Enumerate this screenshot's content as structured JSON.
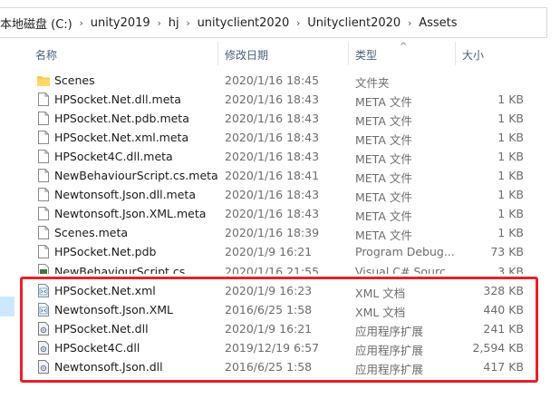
{
  "breadcrumb": [
    "本地磁盘 (C:)",
    "unity2019",
    "hj",
    "unityclient2020",
    "Unityclient2020",
    "Assets"
  ],
  "columns": {
    "name": "名称",
    "date": "修改日期",
    "type": "类型",
    "size": "大小"
  },
  "files": [
    {
      "name": "Scenes",
      "date": "2020/1/16 18:45",
      "type": "文件夹",
      "size": "",
      "icon": "folder-icon"
    },
    {
      "name": "HPSocket.Net.dll.meta",
      "date": "2020/1/16 18:43",
      "type": "META 文件",
      "size": "1 KB",
      "icon": "file-icon"
    },
    {
      "name": "HPSocket.Net.pdb.meta",
      "date": "2020/1/16 18:43",
      "type": "META 文件",
      "size": "1 KB",
      "icon": "file-icon"
    },
    {
      "name": "HPSocket.Net.xml.meta",
      "date": "2020/1/16 18:43",
      "type": "META 文件",
      "size": "1 KB",
      "icon": "file-icon"
    },
    {
      "name": "HPSocket4C.dll.meta",
      "date": "2020/1/16 18:43",
      "type": "META 文件",
      "size": "1 KB",
      "icon": "file-icon"
    },
    {
      "name": "NewBehaviourScript.cs.meta",
      "date": "2020/1/16 18:41",
      "type": "META 文件",
      "size": "1 KB",
      "icon": "file-icon"
    },
    {
      "name": "Newtonsoft.Json.dll.meta",
      "date": "2020/1/16 18:43",
      "type": "META 文件",
      "size": "1 KB",
      "icon": "file-icon"
    },
    {
      "name": "Newtonsoft.Json.XML.meta",
      "date": "2020/1/16 18:43",
      "type": "META 文件",
      "size": "1 KB",
      "icon": "file-icon"
    },
    {
      "name": "Scenes.meta",
      "date": "2020/1/16 18:39",
      "type": "META 文件",
      "size": "1 KB",
      "icon": "file-icon"
    },
    {
      "name": "HPSocket.Net.pdb",
      "date": "2020/1/9 16:21",
      "type": "Program Debug...",
      "size": "73 KB",
      "icon": "file-icon"
    },
    {
      "name": "NewBehaviourScript.cs",
      "date": "2020/1/16 21:55",
      "type": "Visual C# Sourc...",
      "size": "3 KB",
      "icon": "cs-file-icon"
    }
  ],
  "highlighted_files": [
    {
      "name": "HPSocket.Net.xml",
      "date": "2020/1/9 16:23",
      "type": "XML 文档",
      "size": "328 KB",
      "icon": "xml-file-icon"
    },
    {
      "name": "Newtonsoft.Json.XML",
      "date": "2016/6/25 1:58",
      "type": "XML 文档",
      "size": "440 KB",
      "icon": "xml-file-icon"
    },
    {
      "name": "HPSocket.Net.dll",
      "date": "2020/1/9 16:21",
      "type": "应用程序扩展",
      "size": "241 KB",
      "icon": "dll-file-icon"
    },
    {
      "name": "HPSocket4C.dll",
      "date": "2019/12/19 6:57",
      "type": "应用程序扩展",
      "size": "2,594 KB",
      "icon": "dll-file-icon"
    },
    {
      "name": "Newtonsoft.Json.dll",
      "date": "2016/6/25 1:58",
      "type": "应用程序扩展",
      "size": "417 KB",
      "icon": "dll-file-icon"
    }
  ],
  "colors": {
    "highlight_box": "#e8202a",
    "header_text": "#4c607a",
    "nav_selected": "#cce8ff"
  }
}
